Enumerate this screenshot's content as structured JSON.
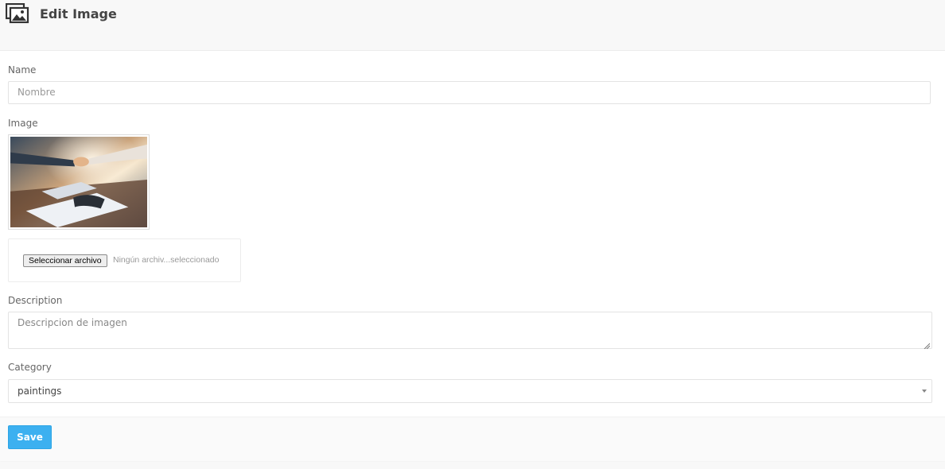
{
  "header": {
    "title": "Edit Image",
    "icon": "image-gallery-icon"
  },
  "form": {
    "name": {
      "label": "Name",
      "placeholder": "Nombre",
      "value": ""
    },
    "image": {
      "label": "Image",
      "file_button_label": "Seleccionar archivo",
      "file_status": "Ningún archiv...seleccionado"
    },
    "description": {
      "label": "Description",
      "placeholder": "Descripcion de imagen",
      "value": ""
    },
    "category": {
      "label": "Category",
      "selected": "paintings"
    }
  },
  "footer": {
    "save_label": "Save"
  },
  "colors": {
    "save_button": "#3cb0f0",
    "page_background": "#f8f8f8",
    "card_background": "#ffffff"
  }
}
